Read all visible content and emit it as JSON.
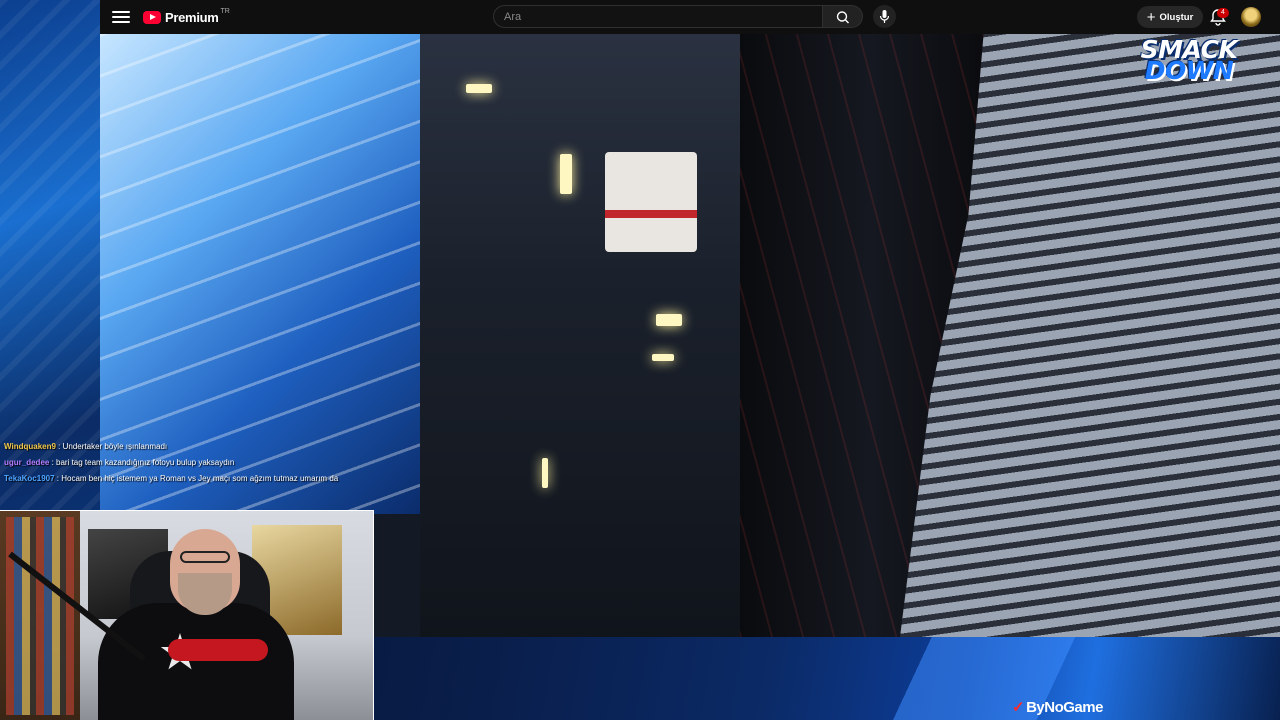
{
  "header": {
    "logo_text": "Premium",
    "logo_suffix": "TR",
    "search_placeholder": "Ara",
    "create_label": "Oluştur",
    "notification_count": "4"
  },
  "video": {
    "overlay_logo_line1": "SMACK",
    "overlay_logo_line2": "DOWN"
  },
  "chat": [
    {
      "user": "Windquaken9",
      "user_color": "#f2c84b",
      "message": "Undertaker böyle ışınlanmadı"
    },
    {
      "user": "ugur_dedee",
      "user_color": "#b37cff",
      "message": "bari tag team kazandığınız fotoyu bulup yaksaydın"
    },
    {
      "user": "TekaKoc1907",
      "user_color": "#4da3ff",
      "message": "Hocam ben hiç istemem ya Roman vs Jey maçı som ağzım tutmaz umarım da"
    }
  ],
  "branding": {
    "sponsor": "ByNoGame"
  },
  "colors": {
    "youtube_red": "#ff0033",
    "header_bg": "#0f0f0f",
    "notification_badge": "#cc0000"
  }
}
